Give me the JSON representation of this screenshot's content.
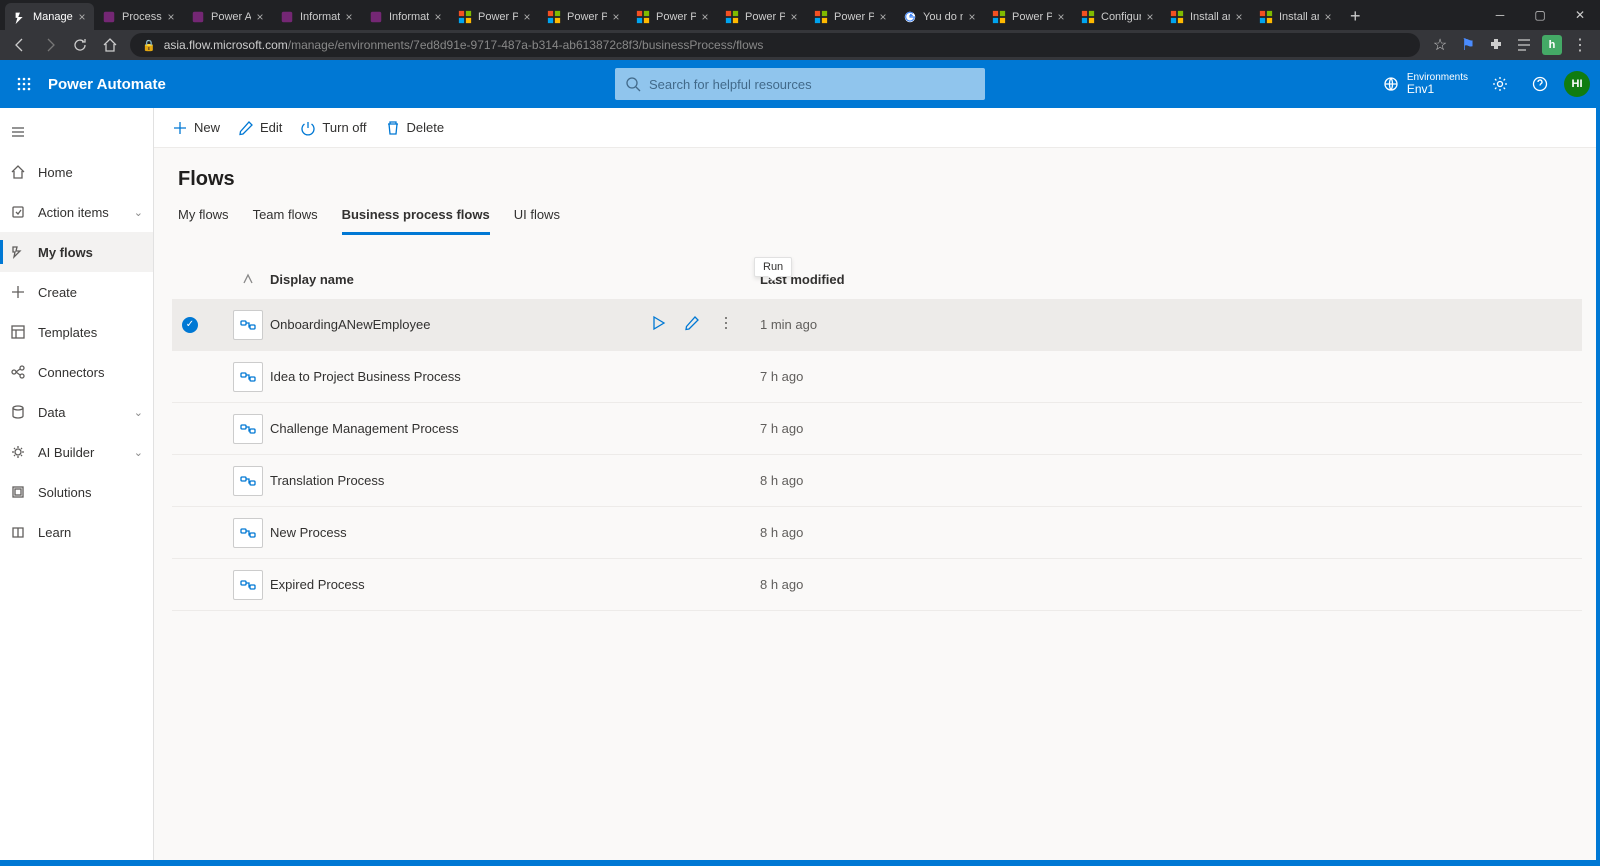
{
  "browser": {
    "tabs": [
      {
        "title": "Manage",
        "favicon": "flow"
      },
      {
        "title": "Process",
        "favicon": "pa"
      },
      {
        "title": "Power A",
        "favicon": "pa"
      },
      {
        "title": "Informat",
        "favicon": "pa"
      },
      {
        "title": "Informat",
        "favicon": "pa"
      },
      {
        "title": "Power Pl",
        "favicon": "ms"
      },
      {
        "title": "Power Pl",
        "favicon": "ms"
      },
      {
        "title": "Power Pl",
        "favicon": "ms"
      },
      {
        "title": "Power Pl",
        "favicon": "ms"
      },
      {
        "title": "Power Pl",
        "favicon": "ms"
      },
      {
        "title": "You do n",
        "favicon": "g"
      },
      {
        "title": "Power Pl",
        "favicon": "ms"
      },
      {
        "title": "Configur",
        "favicon": "ms"
      },
      {
        "title": "Install an",
        "favicon": "ms"
      },
      {
        "title": "Install an",
        "favicon": "ms"
      }
    ],
    "active_tab_index": 0,
    "url_host": "asia.flow.microsoft.com",
    "url_path": "/manage/environments/7ed8d91e-9717-487a-b314-ab613872c8f3/businessProcess/flows",
    "profile_letter": "h"
  },
  "header": {
    "app_name": "Power Automate",
    "search_placeholder": "Search for helpful resources",
    "env_label": "Environments",
    "env_name": "Env1",
    "avatar_initials": "HI"
  },
  "sidebar": {
    "items": [
      {
        "label": "Home",
        "icon": "home"
      },
      {
        "label": "Action items",
        "icon": "action",
        "chevron": true
      },
      {
        "label": "My flows",
        "icon": "flow",
        "active": true
      },
      {
        "label": "Create",
        "icon": "plus"
      },
      {
        "label": "Templates",
        "icon": "template"
      },
      {
        "label": "Connectors",
        "icon": "connector"
      },
      {
        "label": "Data",
        "icon": "data",
        "chevron": true
      },
      {
        "label": "AI Builder",
        "icon": "ai",
        "chevron": true
      },
      {
        "label": "Solutions",
        "icon": "solution"
      },
      {
        "label": "Learn",
        "icon": "learn"
      }
    ]
  },
  "toolbar": {
    "new_label": "New",
    "edit_label": "Edit",
    "turnoff_label": "Turn off",
    "delete_label": "Delete"
  },
  "page": {
    "title": "Flows",
    "tabs": [
      "My flows",
      "Team flows",
      "Business process flows",
      "UI flows"
    ],
    "active_tab_index": 2
  },
  "table": {
    "columns": {
      "name": "Display name",
      "modified": "Last modified"
    },
    "tooltip": "Run",
    "rows": [
      {
        "name": "OnboardingANewEmployee",
        "modified": "1 min ago",
        "selected": true,
        "show_actions": true
      },
      {
        "name": "Idea to Project Business Process",
        "modified": "7 h ago"
      },
      {
        "name": "Challenge Management Process",
        "modified": "7 h ago"
      },
      {
        "name": "Translation Process",
        "modified": "8 h ago"
      },
      {
        "name": "New Process",
        "modified": "8 h ago"
      },
      {
        "name": "Expired Process",
        "modified": "8 h ago"
      }
    ]
  }
}
